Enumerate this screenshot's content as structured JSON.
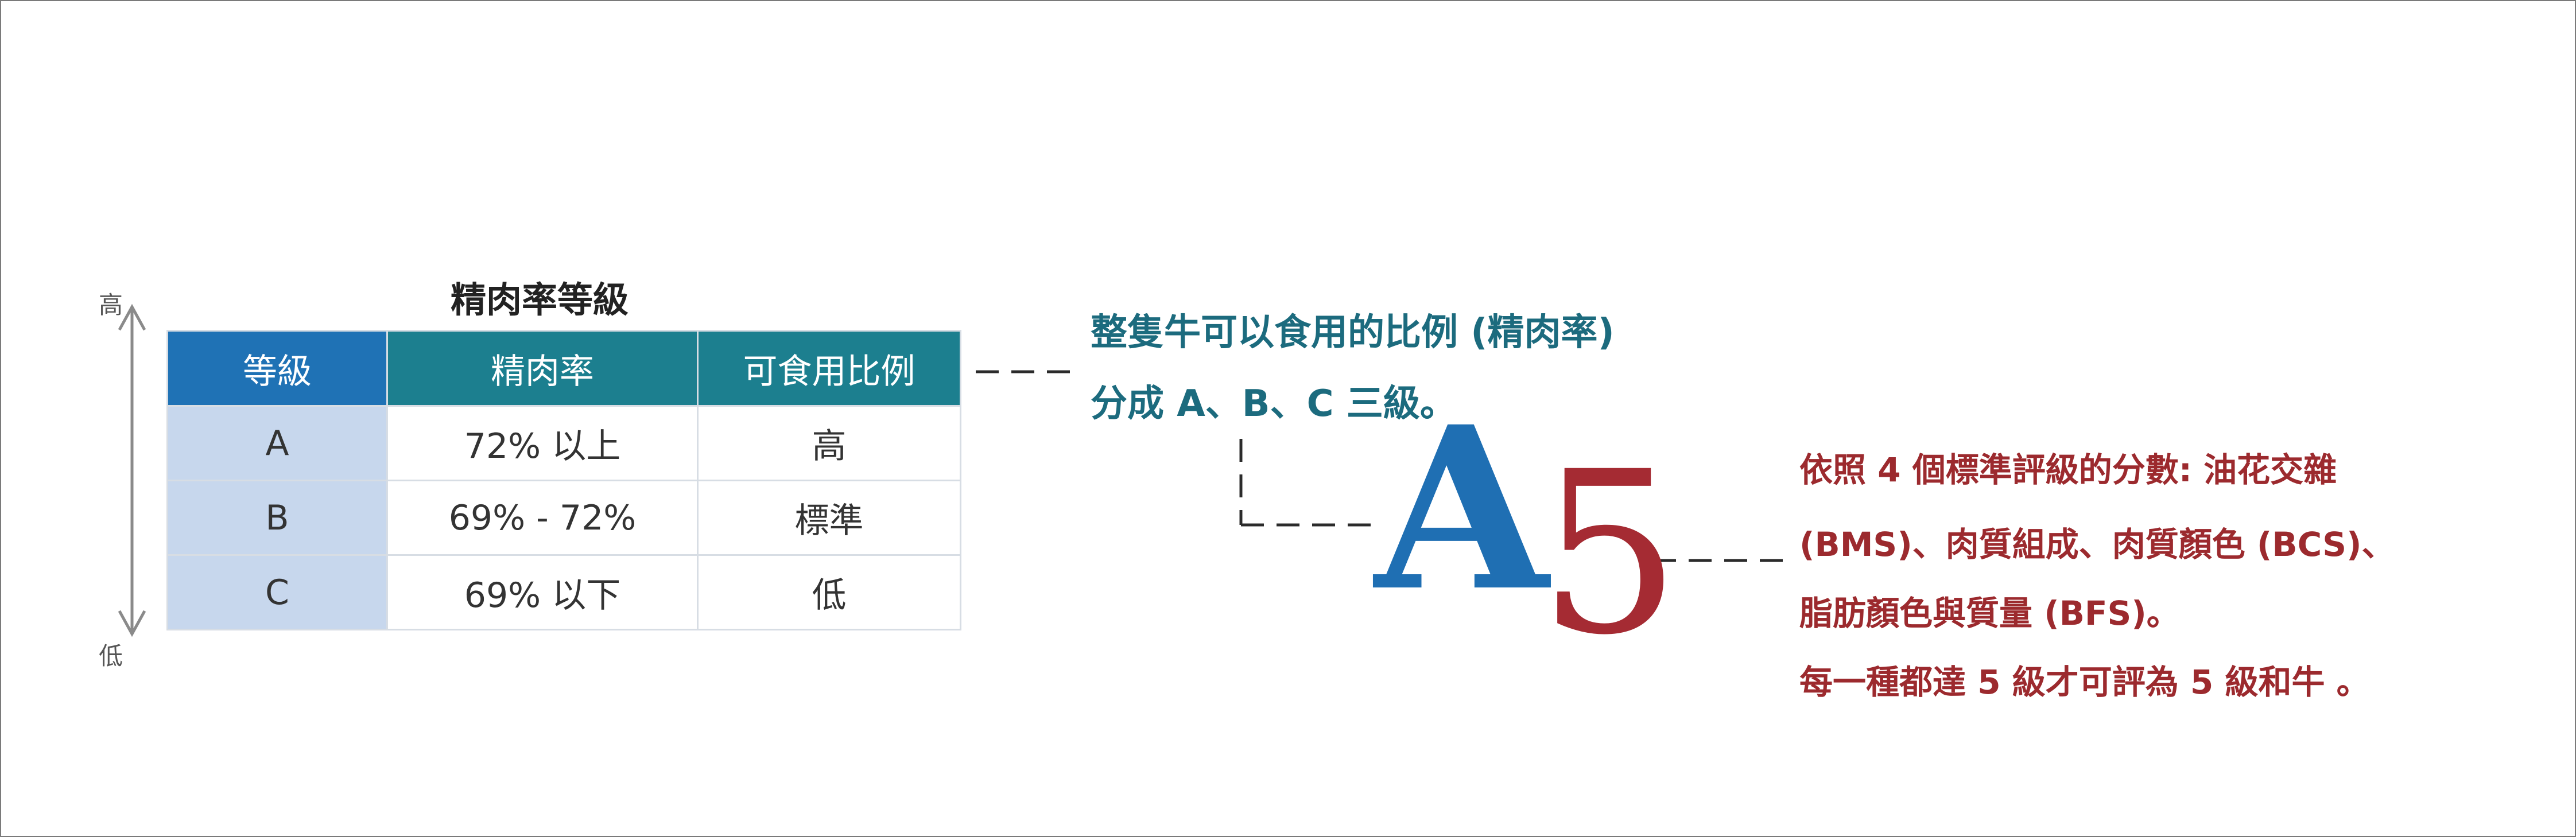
{
  "table_title": "精肉率等級",
  "table": {
    "headers": [
      "等級",
      "精肉率",
      "可食用比例"
    ],
    "rows": [
      [
        "A",
        "72% 以上",
        "高"
      ],
      [
        "B",
        "69% - 72%",
        "標準"
      ],
      [
        "C",
        "69% 以下",
        "低"
      ]
    ]
  },
  "scale": {
    "high": "高",
    "low": "低"
  },
  "yield_note": [
    "整隻牛可以食用的比例 (精肉率)",
    "分成 A、B、C 三級。"
  ],
  "grade_letter": "A",
  "grade_number": "5",
  "quality_note": [
    "依照 4 個標準評級的分數: 油花交雜",
    "(BMS)、肉質組成、肉質顏色 (BCS)、",
    "脂肪顏色與質量 (BFS)。",
    "每一種都達 5 級才可評為 5 級和牛 。"
  ],
  "colors": {
    "blue_header": "#1f72b5",
    "teal_header": "#1c7f8f",
    "grade_column": "#c7d7ed",
    "teal_text": "#1c6b7e",
    "red_text": "#9c2a2e",
    "letter_blue": "#1f6fb3",
    "number_red": "#a52b33"
  }
}
